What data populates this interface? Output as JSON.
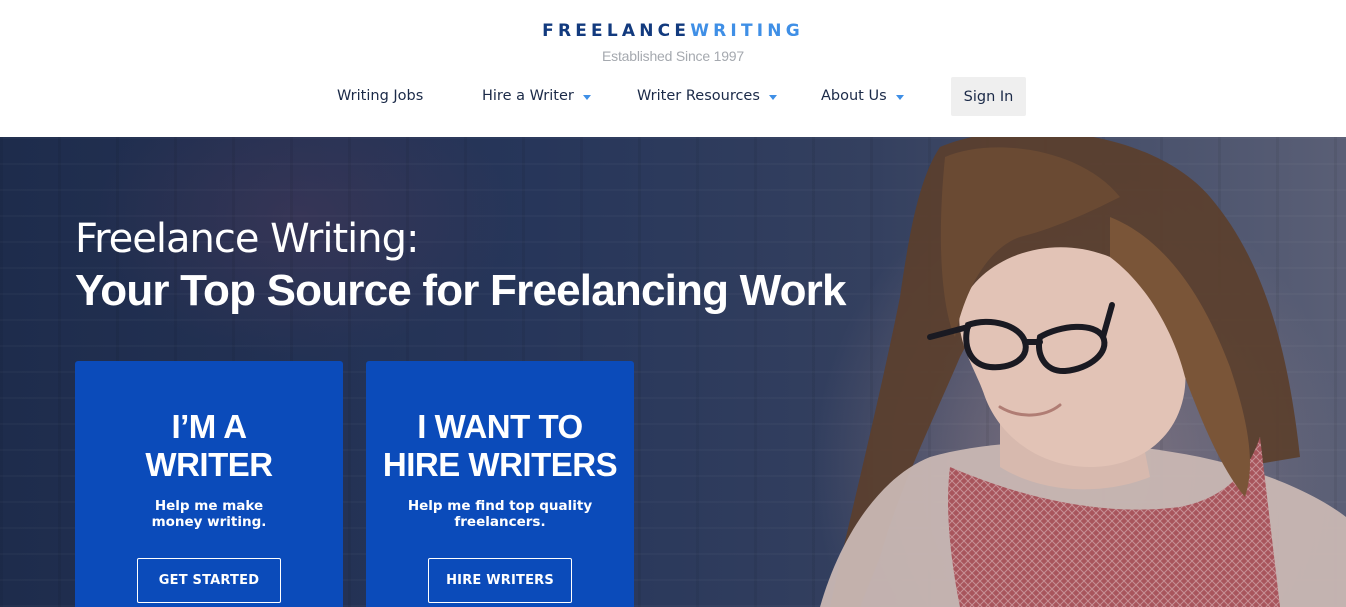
{
  "header": {
    "logo_part1": "FREELANCE",
    "logo_part2": "WRITING",
    "tagline": "Established Since 1997"
  },
  "nav": {
    "items": [
      {
        "label": "Writing Jobs",
        "has_dropdown": false
      },
      {
        "label": "Hire a Writer",
        "has_dropdown": true
      },
      {
        "label": "Writer Resources",
        "has_dropdown": true
      },
      {
        "label": "About Us",
        "has_dropdown": true
      }
    ],
    "signin_label": "Sign In"
  },
  "hero": {
    "headline_line1": "Freelance Writing:",
    "headline_line2": "Your Top Source for Freelancing Work"
  },
  "cards": [
    {
      "title_line1": "I’M A",
      "title_line2": "WRITER",
      "subtitle_line1": "Help me make",
      "subtitle_line2": "money writing.",
      "button_label": "GET STARTED"
    },
    {
      "title_line1": "I WANT TO",
      "title_line2": "HIRE WRITERS",
      "subtitle_line1": "Help me find top quality",
      "subtitle_line2": "freelancers.",
      "button_label": "HIRE WRITERS"
    }
  ],
  "colors": {
    "brand_dark": "#123a7e",
    "brand_light": "#3f8fe6",
    "card_blue": "#0b4bba",
    "nav_text": "#1b2a48",
    "signin_bg": "#efefef"
  }
}
